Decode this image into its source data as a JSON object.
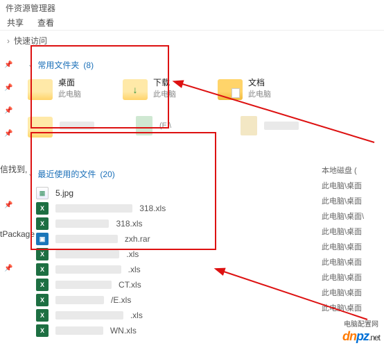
{
  "window": {
    "title_fragment": "件资源管理器",
    "tabs": [
      "共享",
      "查看"
    ]
  },
  "breadcrumb": {
    "chevron": "›",
    "current": "快速访问"
  },
  "sections": {
    "frequent": {
      "label": "常用文件夹",
      "count": "(8)"
    },
    "recent": {
      "label": "最近使用的文件",
      "count": "(20)"
    }
  },
  "folders": [
    {
      "name": "桌面",
      "sub": "此电脑",
      "type": "plain"
    },
    {
      "name": "下载",
      "sub": "此电脑",
      "type": "dl"
    },
    {
      "name": "文档",
      "sub": "此电脑",
      "type": "doc"
    }
  ],
  "drive_fragment": "(E:\\",
  "recent_files": [
    {
      "icon": "img",
      "name": "5.jpg",
      "blur": false
    },
    {
      "icon": "xls",
      "name_partial": "318.xls",
      "blur": true
    },
    {
      "icon": "xls",
      "name_partial": "318.xls",
      "blur": true
    },
    {
      "icon": "rar",
      "name_partial": "zxh.rar",
      "blur": true
    },
    {
      "icon": "xls",
      "name_partial": ".xls",
      "blur": true
    },
    {
      "icon": "xls",
      "name_partial": ".xls",
      "blur": true
    },
    {
      "icon": "xls",
      "name_partial": "CT.xls",
      "blur": true
    },
    {
      "icon": "xls",
      "name_partial": "/E.xls",
      "blur": true
    },
    {
      "icon": "xls",
      "name_partial": ".xls",
      "blur": true
    },
    {
      "icon": "xls",
      "name_partial": "WN.xls",
      "blur": true
    }
  ],
  "right_column": [
    "本地磁盘 (",
    "此电脑\\桌面",
    "此电脑\\桌面",
    "此电脑\\桌面\\",
    "此电脑\\桌面",
    "此电脑\\桌面",
    "此电脑\\桌面",
    "此电脑\\桌面",
    "此电脑\\桌面",
    "此电脑\\桌面"
  ],
  "left_cut_text": "信找到,",
  "left_cut_text2": "tPackage",
  "watermark": {
    "p1": "dn",
    "p2": "pz",
    "suffix": ".net",
    "sub": "电脑配置网"
  }
}
